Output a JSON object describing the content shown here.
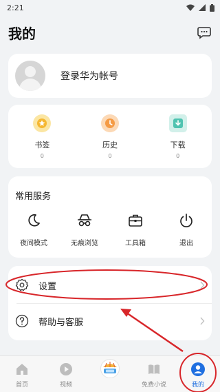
{
  "status_bar": {
    "time": "2:21"
  },
  "header": {
    "title": "我的"
  },
  "login": {
    "label": "登录华为帐号"
  },
  "quick": [
    {
      "label": "书签",
      "count": "0",
      "icon": "star-icon",
      "color": "#f5b731"
    },
    {
      "label": "历史",
      "count": "0",
      "icon": "clock-icon",
      "color": "#f59b45"
    },
    {
      "label": "下载",
      "count": "0",
      "icon": "download-icon",
      "color": "#4fc3b0"
    }
  ],
  "services": {
    "title": "常用服务",
    "items": [
      {
        "label": "夜间模式",
        "icon": "moon-icon"
      },
      {
        "label": "无痕浏览",
        "icon": "incognito-icon"
      },
      {
        "label": "工具箱",
        "icon": "toolbox-icon"
      },
      {
        "label": "退出",
        "icon": "power-icon"
      }
    ]
  },
  "menu": [
    {
      "label": "设置",
      "icon": "gear-icon"
    },
    {
      "label": "帮助与客服",
      "icon": "help-icon"
    }
  ],
  "tabs": [
    {
      "label": "首页",
      "icon": "home-icon"
    },
    {
      "label": "视频",
      "icon": "video-icon"
    },
    {
      "label": "",
      "icon": "center-event-icon"
    },
    {
      "label": "免费小说",
      "icon": "book-icon"
    },
    {
      "label": "我的",
      "icon": "profile-icon",
      "active": true
    }
  ],
  "colors": {
    "accent": "#1f6fe0",
    "annotation": "#d8262a"
  }
}
